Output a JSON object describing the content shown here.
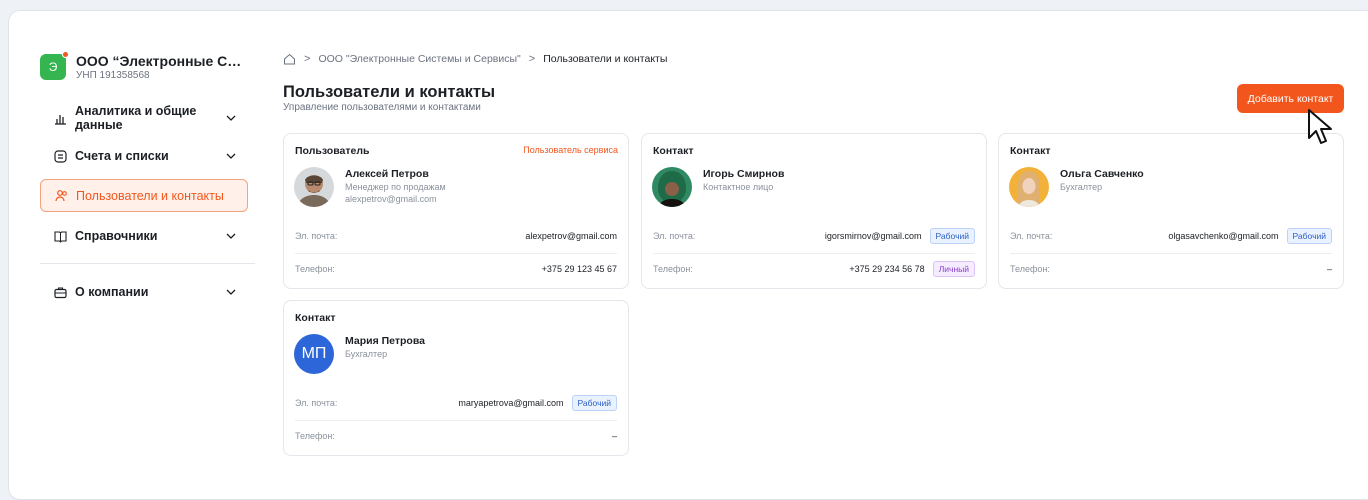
{
  "company": {
    "initial": "Э",
    "name": "ООО “Электронные Сист...",
    "unp": "УНП 191358568"
  },
  "sidebar": {
    "items": [
      {
        "label": "Аналитика и общие данные",
        "icon": "chart-icon"
      },
      {
        "label": "Счета и списки",
        "icon": "list-icon"
      },
      {
        "label": "Пользователи и контакты",
        "icon": "users-icon"
      },
      {
        "label": "Справочники",
        "icon": "book-icon"
      },
      {
        "label": "О компании",
        "icon": "briefcase-icon"
      }
    ]
  },
  "breadcrumb": {
    "sep1": ">",
    "company": "ООО \"Электронные Системы и Сервисы\"",
    "sep2": ">",
    "current": "Пользователи и контакты"
  },
  "page": {
    "title": "Пользователи и контакты",
    "subtitle": "Управление пользователями и контактами"
  },
  "actions": {
    "add_contact": "Добавить контакт"
  },
  "labels": {
    "email": "Эл. почта:",
    "phone": "Телефон:"
  },
  "cards": [
    {
      "type": "Пользователь",
      "badge": "Пользователь сервиса",
      "name": "Алексей Петров",
      "role": "Менеджер по продажам",
      "sub_email": "alexpetrov@gmail.com",
      "email": "alexpetrov@gmail.com",
      "phone": "+375 29 123 45 67"
    },
    {
      "type": "Контакт",
      "name": "Игорь Смирнов",
      "role": "Контактное лицо",
      "email": "igorsmirnov@gmail.com",
      "email_tag": "Рабочий",
      "phone": "+375 29 234 56 78",
      "phone_tag": "Личный"
    },
    {
      "type": "Контакт",
      "name": "Ольга Савченко",
      "role": "Бухгалтер",
      "email": "olgasavchenko@gmail.com",
      "email_tag": "Рабочий",
      "phone": "–"
    },
    {
      "type": "Контакт",
      "initials": "МП",
      "name": "Мария Петрова",
      "role": "Бухгалтер",
      "email": "maryapetrova@gmail.com",
      "email_tag": "Рабочий",
      "phone": "–"
    }
  ],
  "colors": {
    "accent": "#f2561d",
    "logo_green": "#34b550",
    "initials_blue": "#2c66d8"
  }
}
